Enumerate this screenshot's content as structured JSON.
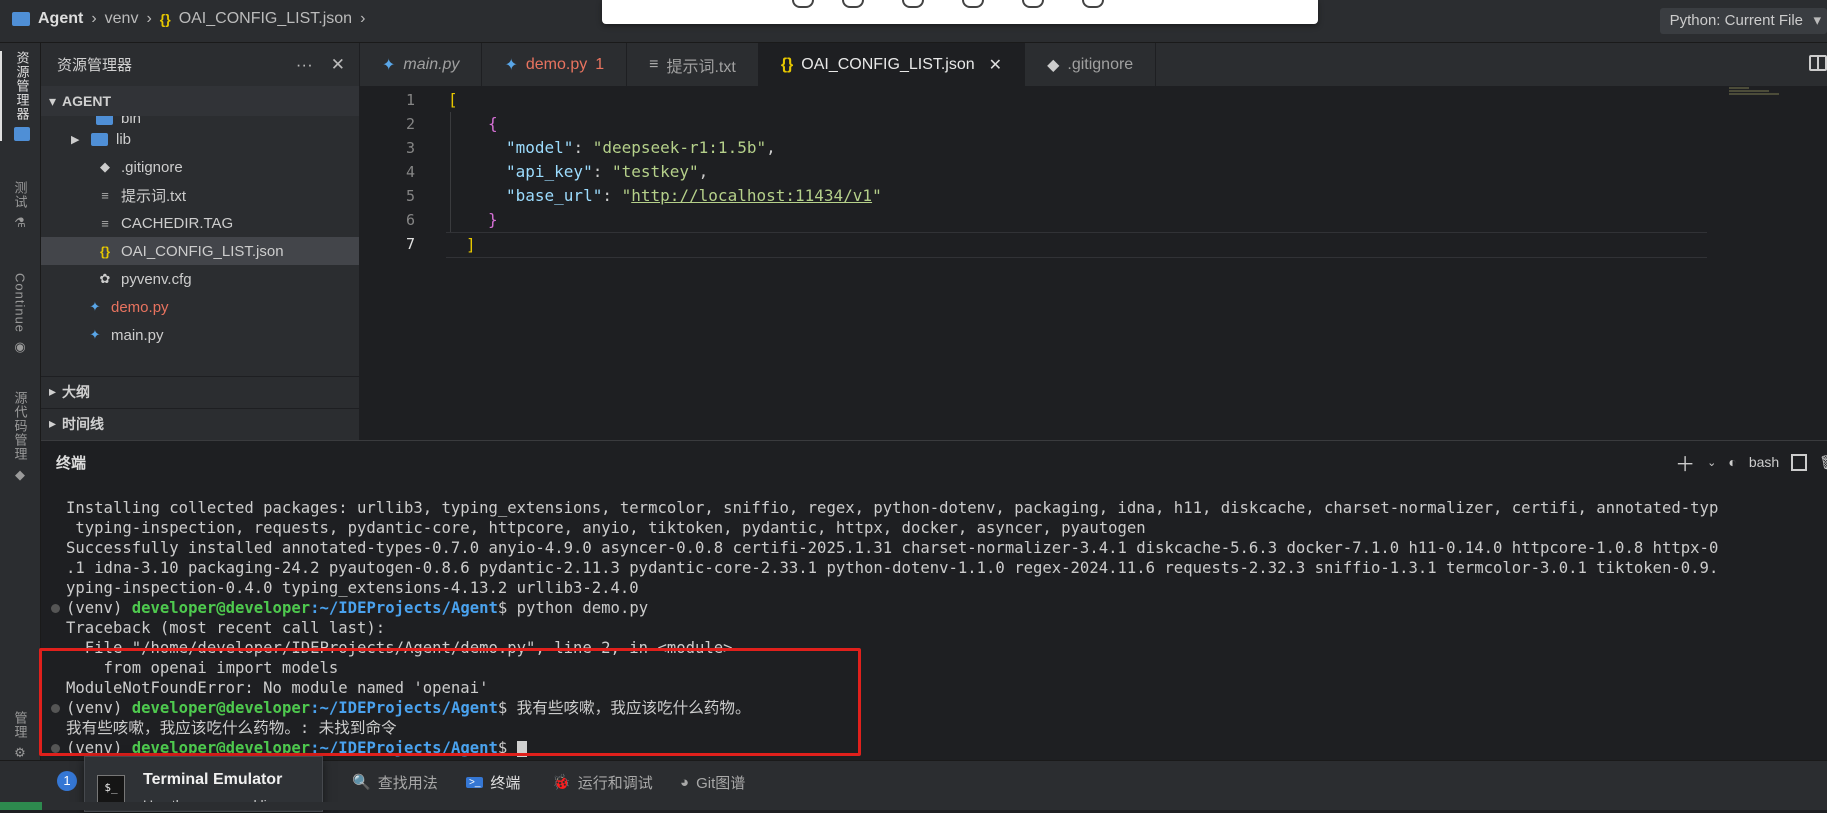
{
  "breadcrumb": {
    "project": "Agent",
    "folder": "venv",
    "file": "OAI_CONFIG_LIST.json"
  },
  "run_config": "Python: Current File",
  "activity": {
    "explorer": "资源管理器",
    "test": "测试",
    "continue": "Continue",
    "scm": "源代码管理",
    "manage": "管理"
  },
  "explorer": {
    "title": "资源管理器",
    "more": "···",
    "close": "✕",
    "root": "AGENT",
    "partial_item": "bin",
    "items": [
      {
        "label": "lib"
      },
      {
        "label": ".gitignore"
      },
      {
        "label": "提示词.txt"
      },
      {
        "label": "CACHEDIR.TAG"
      },
      {
        "label": "OAI_CONFIG_LIST.json"
      },
      {
        "label": "pyvenv.cfg"
      },
      {
        "label": "demo.py",
        "badge": "1"
      },
      {
        "label": "main.py"
      }
    ],
    "outline": "大纲",
    "timeline": "时间线"
  },
  "tabs": [
    {
      "label": "main.py"
    },
    {
      "label": "demo.py",
      "badge": "1"
    },
    {
      "label": "提示词.txt"
    },
    {
      "label": "OAI_CONFIG_LIST.json"
    },
    {
      "label": ".gitignore"
    }
  ],
  "editor": {
    "line_numbers": [
      "1",
      "2",
      "3",
      "4",
      "5",
      "6",
      "7"
    ],
    "lines": [
      "[",
      "{",
      "\"model\": \"deepseek-r1:1.5b\",",
      "\"api_key\": \"testkey\",",
      "\"base_url\": \"http://localhost:11434/v1\"",
      "}",
      "]"
    ],
    "json": {
      "k1": "\"model\"",
      "v1": "\"deepseek-r1:1.5b\"",
      "k2": "\"api_key\"",
      "v2": "\"testkey\"",
      "k3": "\"base_url\"",
      "v3": "http://localhost:11434/v1"
    }
  },
  "terminal": {
    "title": "终端",
    "shell": "bash",
    "lines": [
      "Installing collected packages: urllib3, typing_extensions, termcolor, sniffio, regex, python-dotenv, packaging, idna, h11, diskcache, charset-normalizer, certifi, annotated-typ",
      " typing-inspection, requests, pydantic-core, httpcore, anyio, tiktoken, pydantic, httpx, docker, asyncer, pyautogen",
      "Successfully installed annotated-types-0.7.0 anyio-4.9.0 asyncer-0.0.8 certifi-2025.1.31 charset-normalizer-3.4.1 diskcache-5.6.3 docker-7.1.0 h11-0.14.0 httpcore-1.0.8 httpx-0",
      ".1 idna-3.10 packaging-24.2 pyautogen-0.8.6 pydantic-2.11.3 pydantic-core-2.33.1 python-dotenv-1.1.0 regex-2024.11.6 requests-2.32.3 sniffio-1.3.1 termcolor-3.0.1 tiktoken-0.9.",
      "yping-inspection-0.4.0 typing_extensions-4.13.2 urllib3-2.4.0"
    ],
    "venv": "(venv)",
    "user": "developer@developer",
    "path": ":~/IDEProjects/Agent",
    "prompt_end": "$",
    "cmd1": "python demo.py",
    "traceback": "Traceback (most recent call last):",
    "file_line": "  File \"/home/developer/IDEProjects/Agent/demo.py\", line 2, in <module>",
    "import_line": "    from openai import models",
    "error": "ModuleNotFoundError: No module named 'openai'",
    "cmd2": "我有些咳嗽，我应该吃什么药物。",
    "not_found": "我有些咳嗽，我应该吃什么药物。: 未找到命令"
  },
  "bottom_bar": {
    "notification_count": "1",
    "find_usages": "查找用法",
    "terminal": "终端",
    "run_debug": "运行和调试",
    "git_graph": "Git图谱"
  },
  "tooltip": {
    "icon": "$_",
    "title": "Terminal Emulator",
    "subtitle": "Use the command line"
  }
}
